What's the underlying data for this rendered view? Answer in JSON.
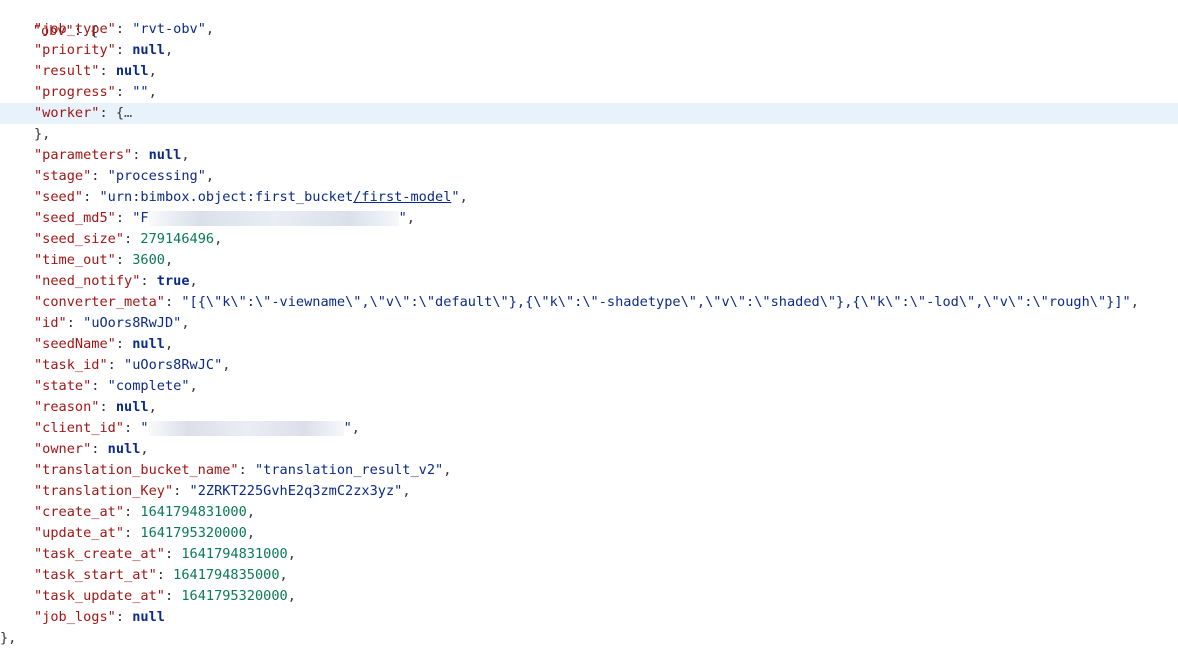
{
  "root_key": "obv",
  "fields": {
    "job_type": "rvt-obv",
    "priority": "null",
    "result": "null",
    "progress": "",
    "worker_collapsed": "…",
    "parameters": "null",
    "stage": "processing",
    "seed_prefix": "urn:bimbox.object:first_bucket",
    "seed_suffix": "/first-model",
    "seed_md5_visible": "F",
    "seed_size": "279146496",
    "time_out": "3600",
    "need_notify": "true",
    "converter_meta": "[{\\\"k\\\":\\\"-viewname\\\",\\\"v\\\":\\\"default\\\"},{\\\"k\\\":\\\"-shadetype\\\",\\\"v\\\":\\\"shaded\\\"},{\\\"k\\\":\\\"-lod\\\",\\\"v\\\":\\\"rough\\\"}]",
    "id": "uOors8RwJD",
    "seedName": "null",
    "task_id": "uOors8RwJC",
    "state": "complete",
    "reason": "null",
    "owner": "null",
    "translation_bucket_name": "translation_result_v2",
    "translation_Key": "2ZRKT225GvhE2q3zmC2zx3yz",
    "create_at": "1641794831000",
    "update_at": "1641795320000",
    "task_create_at": "1641794831000",
    "task_start_at": "1641794835000",
    "task_update_at": "1641795320000",
    "job_logs": "null"
  },
  "colors": {
    "key": "#a31515",
    "string": "#0b2a8a",
    "number": "#0a7a55",
    "keyword": "#0b2a8a",
    "highlight": "#e8f2fb"
  }
}
